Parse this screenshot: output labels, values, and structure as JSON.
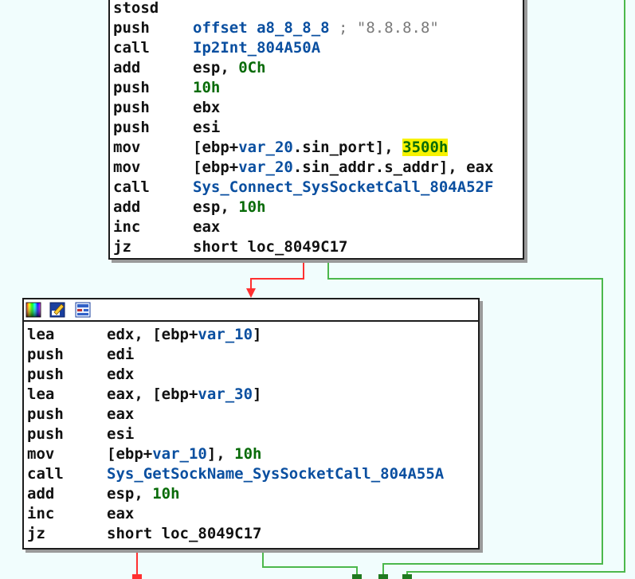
{
  "colors": {
    "background": "#f1fdfd",
    "false_edge": "#ff3030",
    "true_edge": "#4cb84c",
    "name": "#0a4fa0",
    "number": "#086b08",
    "highlight": "#f7f200"
  },
  "block1": {
    "lines": [
      {
        "mnem": "stosd",
        "operands": []
      },
      {
        "mnem": "push",
        "operands": [
          {
            "t": "offset a8_8_8_8 ",
            "k": "name"
          },
          {
            "t": "; \"8.8.8.8\"",
            "k": "cmt"
          }
        ]
      },
      {
        "mnem": "call",
        "operands": [
          {
            "t": "Ip2Int_804A50A",
            "k": "name"
          }
        ]
      },
      {
        "mnem": "add",
        "operands": [
          {
            "t": "esp, ",
            "k": "text"
          },
          {
            "t": "0Ch",
            "k": "num"
          }
        ]
      },
      {
        "mnem": "push",
        "operands": [
          {
            "t": "10h",
            "k": "num"
          }
        ]
      },
      {
        "mnem": "push",
        "operands": [
          {
            "t": "ebx",
            "k": "text"
          }
        ]
      },
      {
        "mnem": "push",
        "operands": [
          {
            "t": "esi",
            "k": "text"
          }
        ]
      },
      {
        "mnem": "mov",
        "operands": [
          {
            "t": "[ebp+",
            "k": "text"
          },
          {
            "t": "var_20",
            "k": "sym"
          },
          {
            "t": ".sin_port], ",
            "k": "text"
          },
          {
            "t": "3500h",
            "k": "num",
            "hl": true
          }
        ]
      },
      {
        "mnem": "mov",
        "operands": [
          {
            "t": "[ebp+",
            "k": "text"
          },
          {
            "t": "var_20",
            "k": "sym"
          },
          {
            "t": ".sin_addr.s_addr], eax",
            "k": "text"
          }
        ]
      },
      {
        "mnem": "call",
        "operands": [
          {
            "t": "Sys_Connect_SysSocketCall_804A52F",
            "k": "name"
          }
        ]
      },
      {
        "mnem": "add",
        "operands": [
          {
            "t": "esp, ",
            "k": "text"
          },
          {
            "t": "10h",
            "k": "num"
          }
        ]
      },
      {
        "mnem": "inc",
        "operands": [
          {
            "t": "eax",
            "k": "text"
          }
        ]
      },
      {
        "mnem": "jz",
        "operands": [
          {
            "t": "short loc_8049C17",
            "k": "text"
          }
        ]
      }
    ]
  },
  "block2": {
    "icons": [
      "color-palette-icon",
      "edit-pencil-icon",
      "graph-view-icon"
    ],
    "lines": [
      {
        "mnem": "lea",
        "operands": [
          {
            "t": "edx, [ebp+",
            "k": "text"
          },
          {
            "t": "var_10",
            "k": "sym"
          },
          {
            "t": "]",
            "k": "text"
          }
        ]
      },
      {
        "mnem": "push",
        "operands": [
          {
            "t": "edi",
            "k": "text"
          }
        ]
      },
      {
        "mnem": "push",
        "operands": [
          {
            "t": "edx",
            "k": "text"
          }
        ]
      },
      {
        "mnem": "lea",
        "operands": [
          {
            "t": "eax, [ebp+",
            "k": "text"
          },
          {
            "t": "var_30",
            "k": "sym"
          },
          {
            "t": "]",
            "k": "text"
          }
        ]
      },
      {
        "mnem": "push",
        "operands": [
          {
            "t": "eax",
            "k": "text"
          }
        ]
      },
      {
        "mnem": "push",
        "operands": [
          {
            "t": "esi",
            "k": "text"
          }
        ]
      },
      {
        "mnem": "mov",
        "operands": [
          {
            "t": "[ebp+",
            "k": "text"
          },
          {
            "t": "var_10",
            "k": "sym"
          },
          {
            "t": "], ",
            "k": "text"
          },
          {
            "t": "10h",
            "k": "num"
          }
        ]
      },
      {
        "mnem": "call",
        "operands": [
          {
            "t": "Sys_GetSockName_SysSocketCall_804A55A",
            "k": "name"
          }
        ]
      },
      {
        "mnem": "add",
        "operands": [
          {
            "t": "esp, ",
            "k": "text"
          },
          {
            "t": "10h",
            "k": "num"
          }
        ]
      },
      {
        "mnem": "inc",
        "operands": [
          {
            "t": "eax",
            "k": "text"
          }
        ]
      },
      {
        "mnem": "jz",
        "operands": [
          {
            "t": "short loc_8049C17",
            "k": "text"
          }
        ]
      }
    ]
  }
}
